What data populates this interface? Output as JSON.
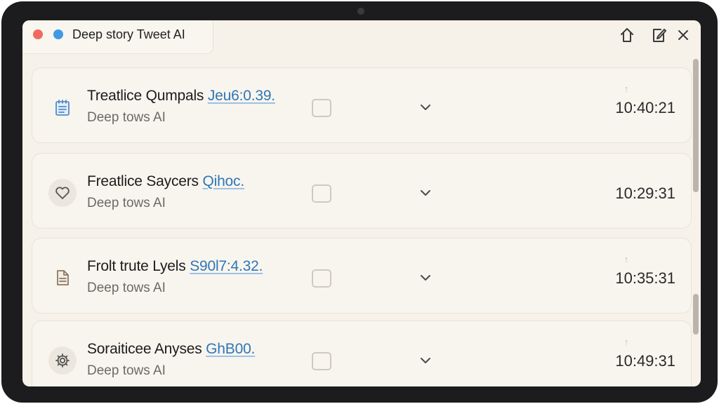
{
  "window": {
    "title": "Deep story Tweet AI"
  },
  "toolbar": {
    "icons": [
      "home-icon",
      "edit-icon",
      "close-icon"
    ]
  },
  "items": [
    {
      "icon": "notepad-icon",
      "title": "Treatlice Qumpals",
      "tag": "Jeu6:0.39.",
      "subtitle": "Deep tows AI",
      "time": "10:40:21",
      "pin": "↑"
    },
    {
      "icon": "heart-icon",
      "title": "Freatlice Saycers",
      "tag": "Qihoc.",
      "subtitle": "Deep tows AI",
      "time": "10:29:31",
      "pin": "↑"
    },
    {
      "icon": "document-icon",
      "title": "Frolt trute Lyels",
      "tag": "S90l7:4.32.",
      "subtitle": "Deep tows AI",
      "time": "10:35:31",
      "pin": "↑"
    },
    {
      "icon": "gear-icon",
      "title": "Soraiticee Anyses",
      "tag": "GhB00.",
      "subtitle": "Deep tows AI",
      "time": "10:49:31",
      "pin": "↑"
    }
  ],
  "colors": {
    "accent": "#2f76b8",
    "close_dot": "#ef6b5e",
    "info_dot": "#3f9ae6"
  }
}
